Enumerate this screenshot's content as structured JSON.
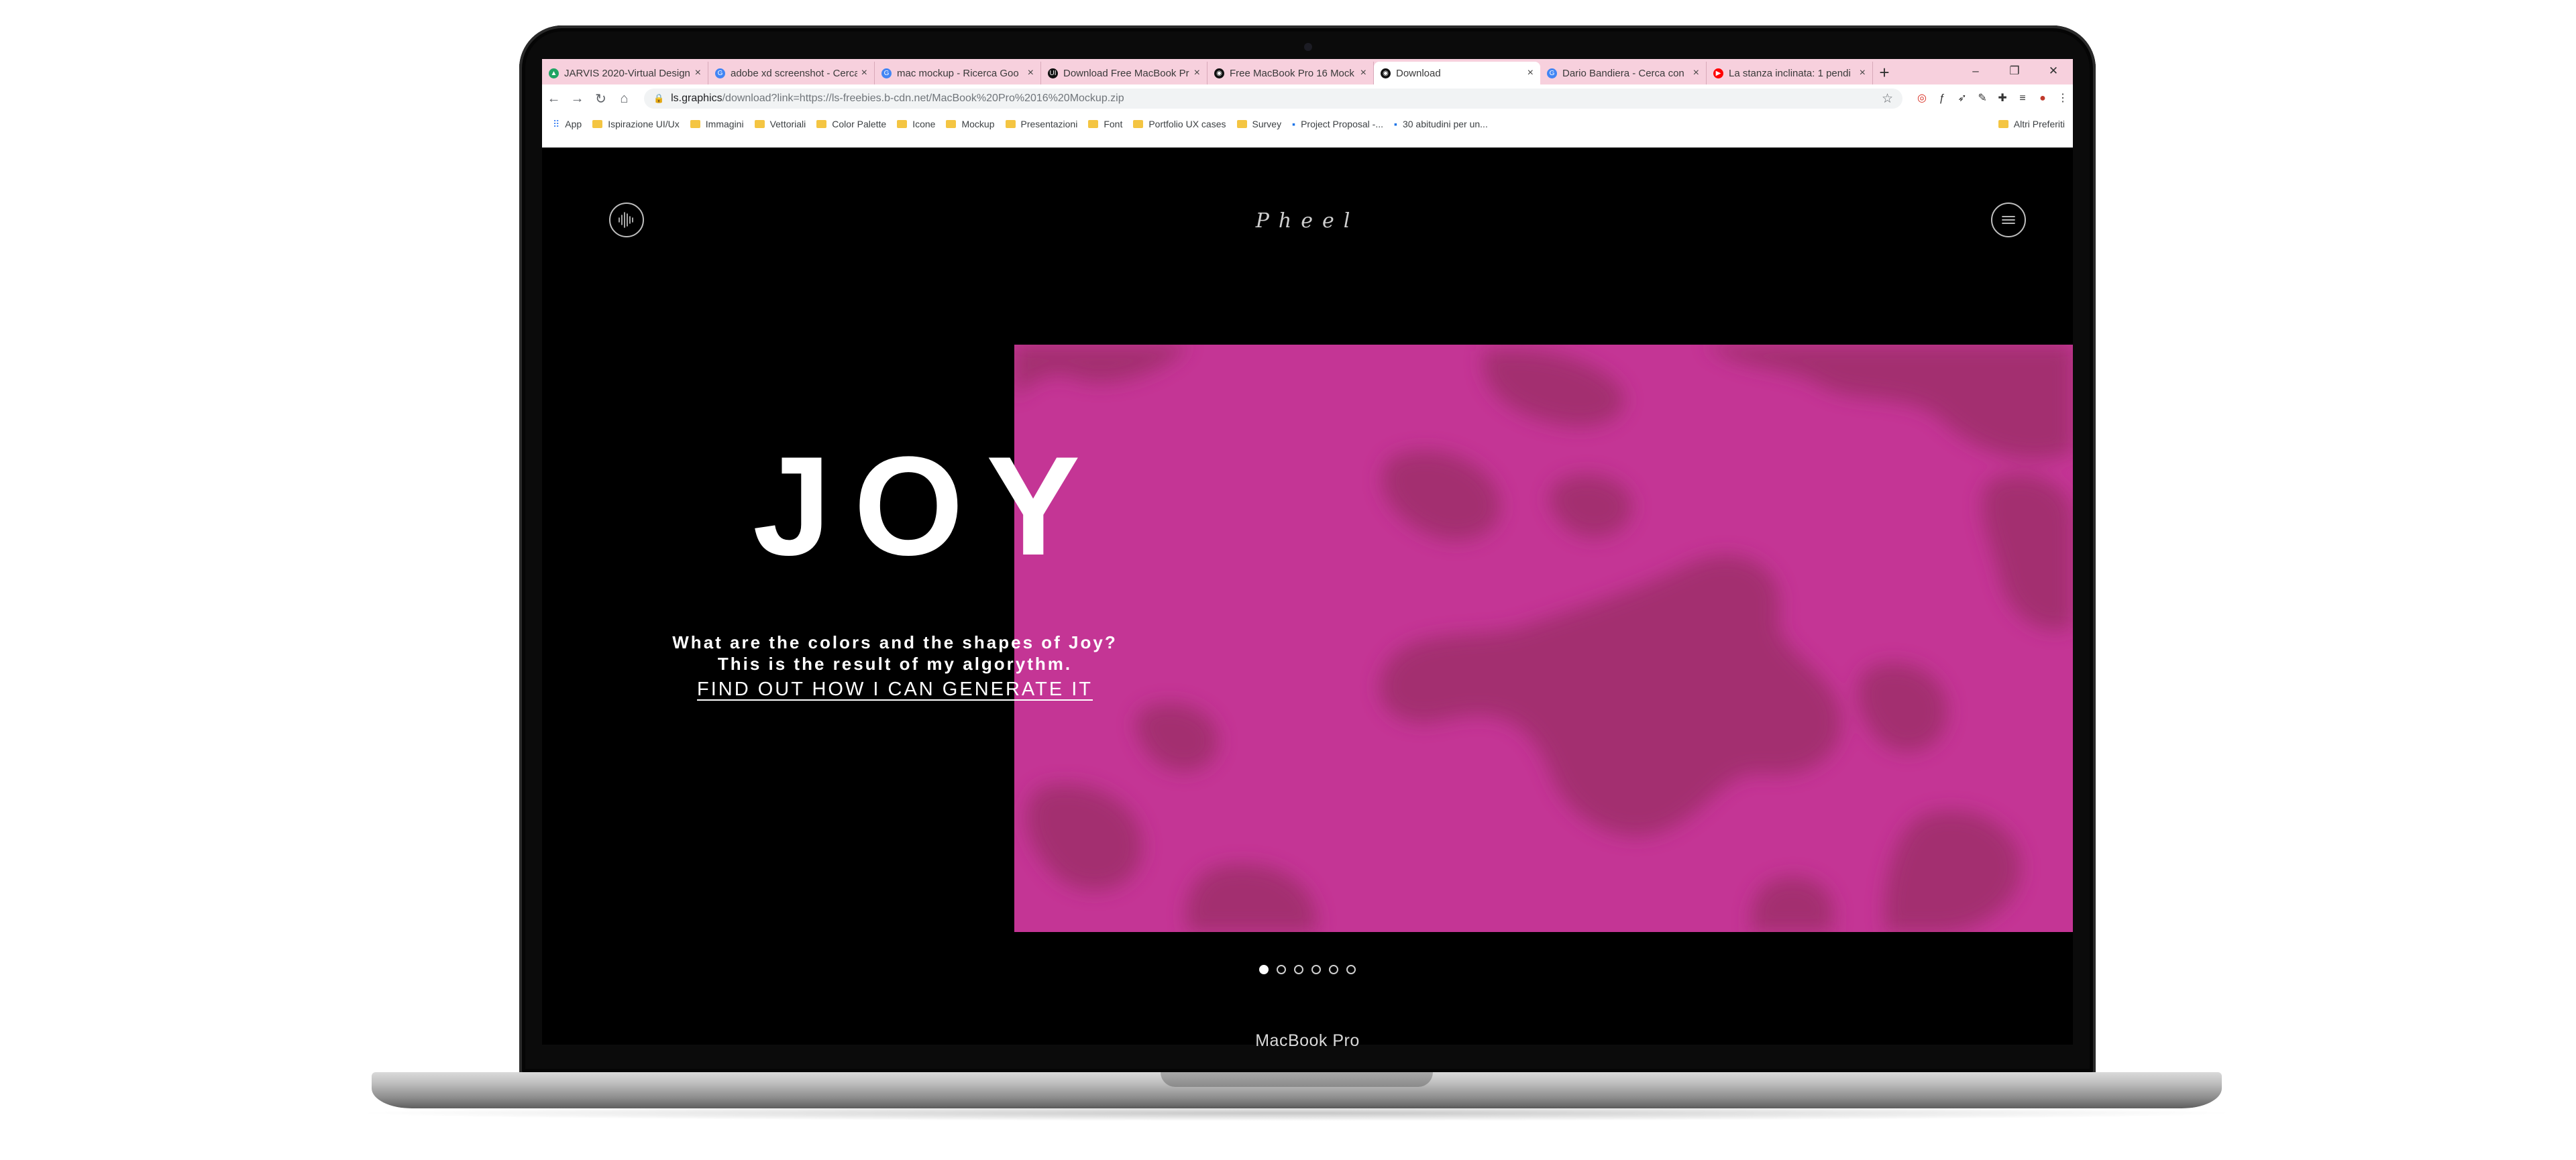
{
  "device": {
    "label": "MacBook Pro"
  },
  "browser": {
    "tabs": [
      {
        "title": "JARVIS 2020-Virtual Design",
        "icon": "drive-icon",
        "color": "#1fa463",
        "active": false
      },
      {
        "title": "adobe xd screenshot - Cerca",
        "icon": "google-icon",
        "color": "#4285f4",
        "active": false
      },
      {
        "title": "mac mockup - Ricerca Goo",
        "icon": "google-icon",
        "color": "#4285f4",
        "active": false
      },
      {
        "title": "Download Free MacBook Pr",
        "icon": "ui-icon",
        "color": "#111111",
        "active": false
      },
      {
        "title": "Free MacBook Pro 16 Mock",
        "icon": "ls-icon",
        "color": "#111111",
        "active": false
      },
      {
        "title": "Download",
        "icon": "ls-icon",
        "color": "#111111",
        "active": true
      },
      {
        "title": "Dario Bandiera - Cerca con",
        "icon": "google-icon",
        "color": "#4285f4",
        "active": false
      },
      {
        "title": "La stanza inclinata: 1 pendi",
        "icon": "youtube-icon",
        "color": "#ff0000",
        "active": false
      }
    ],
    "url": {
      "host": "ls.graphics",
      "path": "/download?link=https://ls-freebies.b-cdn.net/MacBook%20Pro%2016%20Mockup.zip"
    },
    "bookmarks": [
      {
        "label": "App",
        "type": "apps"
      },
      {
        "label": "Ispirazione UI/Ux",
        "type": "folder"
      },
      {
        "label": "Immagini",
        "type": "folder"
      },
      {
        "label": "Vettoriali",
        "type": "folder"
      },
      {
        "label": "Color Palette",
        "type": "folder"
      },
      {
        "label": "Icone",
        "type": "folder"
      },
      {
        "label": "Mockup",
        "type": "folder"
      },
      {
        "label": "Presentazioni",
        "type": "folder"
      },
      {
        "label": "Font",
        "type": "folder"
      },
      {
        "label": "Portfolio UX cases",
        "type": "folder"
      },
      {
        "label": "Survey",
        "type": "folder"
      },
      {
        "label": "Project Proposal -...",
        "type": "site"
      },
      {
        "label": "30 abitudini per un...",
        "type": "site"
      }
    ],
    "bookmarks_other": "Altri Preferiti"
  },
  "page": {
    "brand": "Pheel",
    "hero": {
      "title": "JOY",
      "subtitle_line1": "What are the colors and the shapes of Joy?",
      "subtitle_line2": "This is the result of my algorythm.",
      "cta": "FIND OUT HOW I CAN GENERATE IT"
    },
    "slider": {
      "count": 6,
      "active_index": 0
    },
    "colors": {
      "art_base": "#c43595",
      "art_blob": "#a0306a",
      "background": "#000000"
    }
  }
}
